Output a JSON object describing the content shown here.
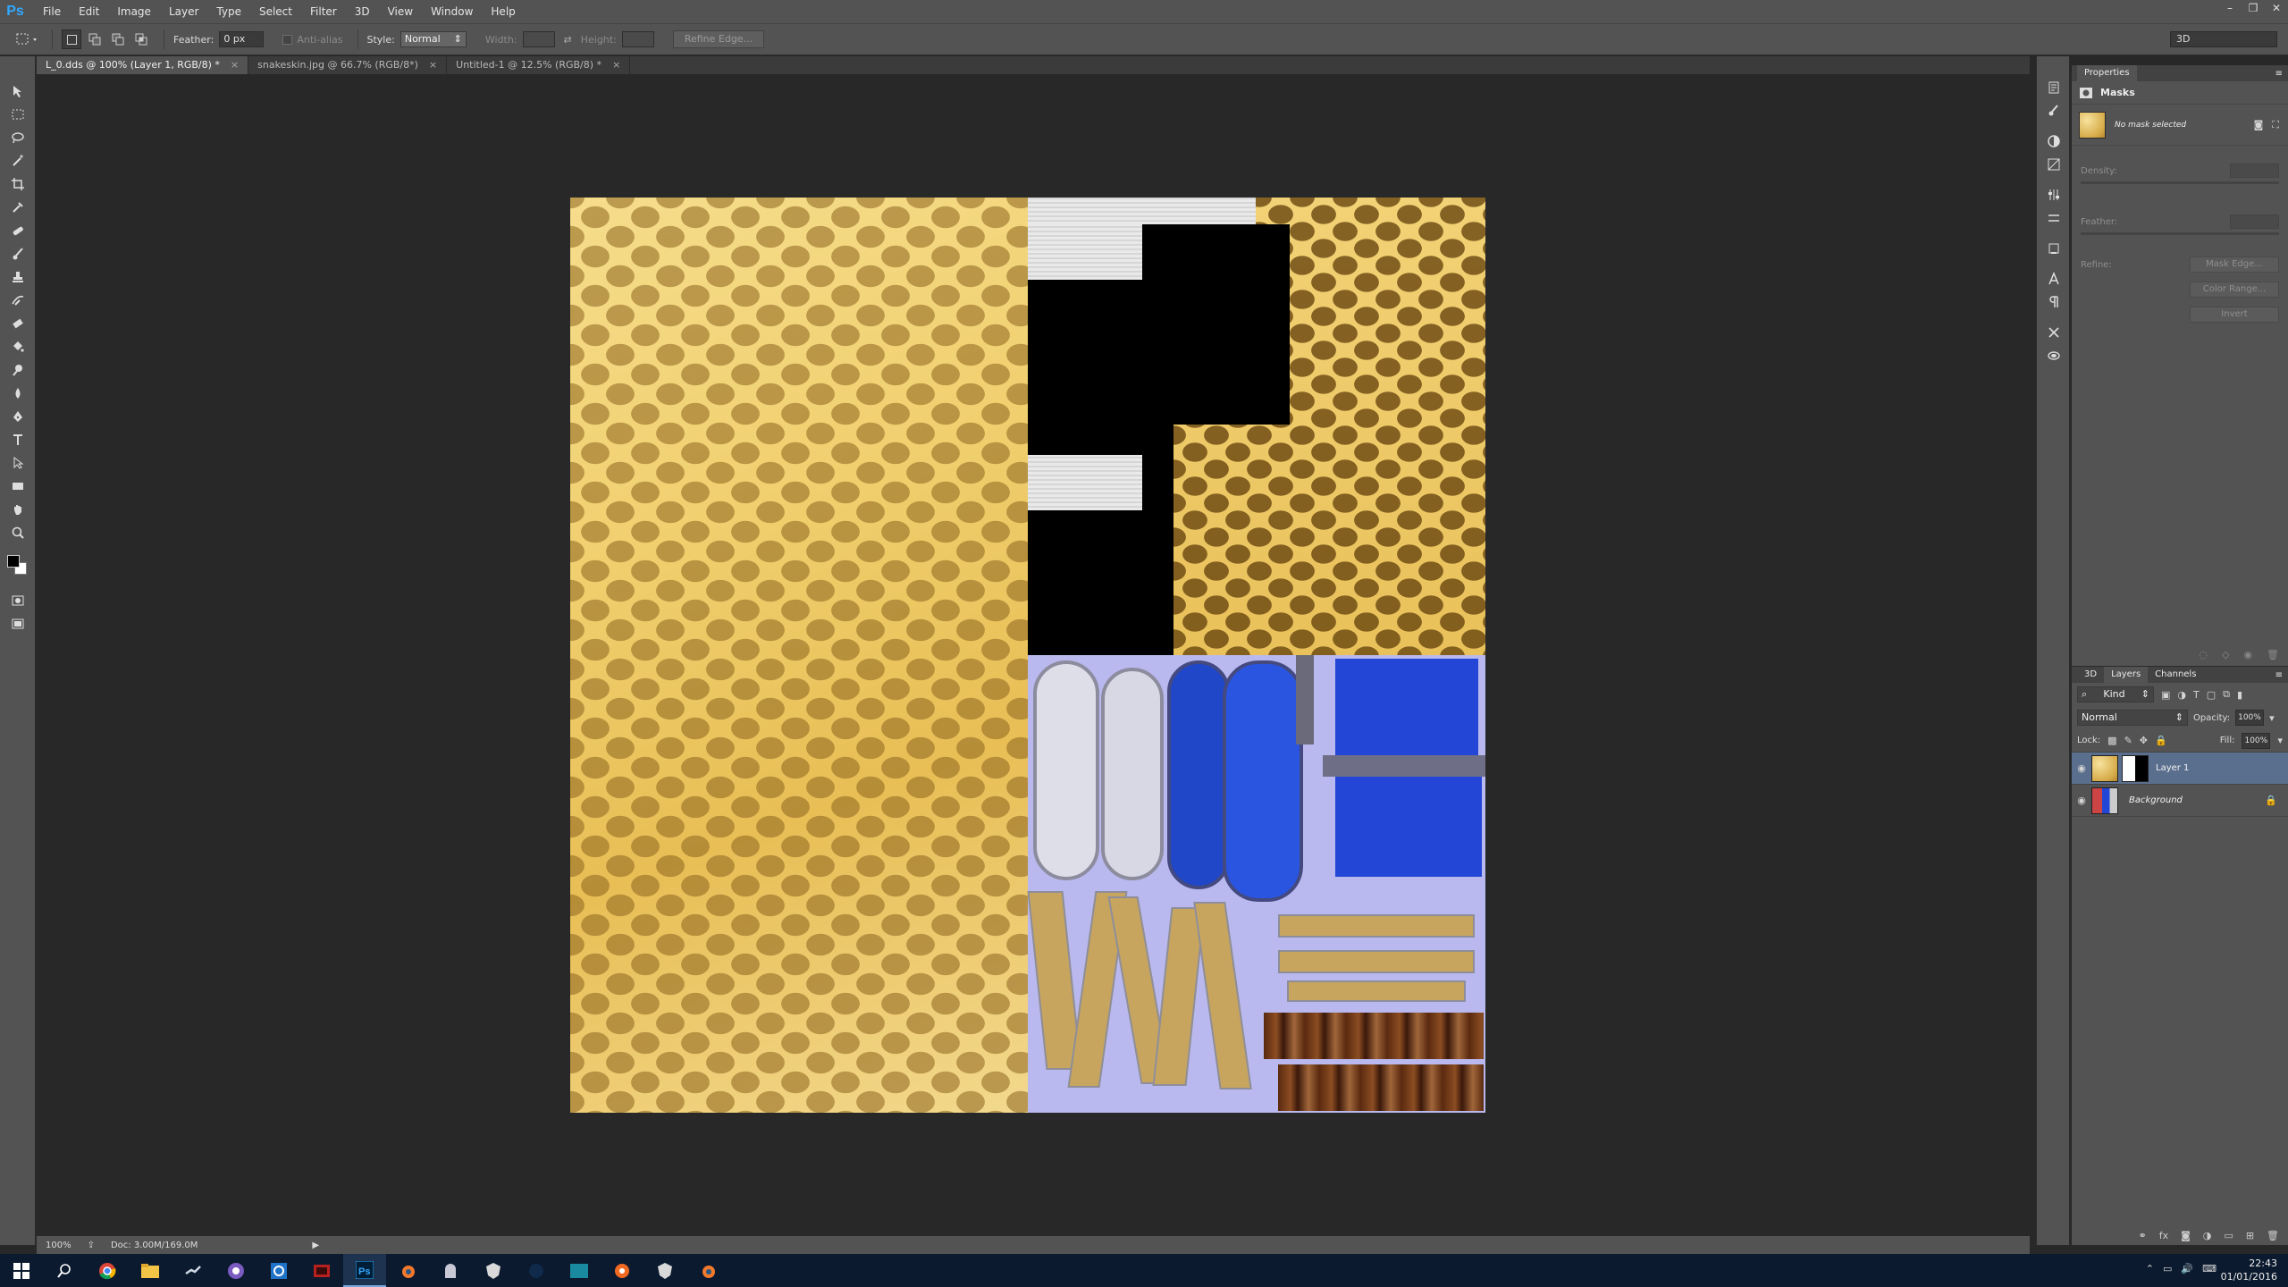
{
  "app": {
    "logo": "Ps"
  },
  "menu": [
    "File",
    "Edit",
    "Image",
    "Layer",
    "Type",
    "Select",
    "Filter",
    "3D",
    "View",
    "Window",
    "Help"
  ],
  "window_controls": [
    "–",
    "❐",
    "✕"
  ],
  "options": {
    "feather_label": "Feather:",
    "feather_value": "0 px",
    "antialias_label": "Anti-alias",
    "style_label": "Style:",
    "style_value": "Normal",
    "width_label": "Width:",
    "height_label": "Height:",
    "refine_edge": "Refine Edge...",
    "workspace": "3D"
  },
  "tabs": [
    {
      "label": "L_0.dds @ 100% (Layer 1, RGB/8) *",
      "active": true
    },
    {
      "label": "snakeskin.jpg @ 66.7% (RGB/8*)",
      "active": false
    },
    {
      "label": "Untitled-1 @ 12.5% (RGB/8) *",
      "active": false
    }
  ],
  "status": {
    "zoom": "100%",
    "doc": "Doc: 3.00M/169.0M"
  },
  "properties": {
    "title": "Properties",
    "section": "Masks",
    "no_mask": "No mask selected",
    "density_label": "Density:",
    "feather_label": "Feather:",
    "refine_label": "Refine:",
    "mask_edge": "Mask Edge...",
    "color_range": "Color Range...",
    "invert": "Invert"
  },
  "layers_panel": {
    "tabs": [
      "3D",
      "Layers",
      "Channels"
    ],
    "active_tab": "Layers",
    "kind": "Kind",
    "blend": "Normal",
    "opacity_label": "Opacity:",
    "opacity": "100%",
    "lock_label": "Lock:",
    "fill_label": "Fill:",
    "fill": "100%",
    "layers": [
      {
        "name": "Layer 1",
        "selected": true
      },
      {
        "name": "Background",
        "selected": false,
        "locked": true
      }
    ]
  },
  "taskbar": {
    "time": "22:43",
    "date": "01/01/2016"
  },
  "colors": {
    "accent": "#31a8ff",
    "panel": "#535353",
    "canvas": "#282828",
    "selection": "#5a6f8e"
  }
}
